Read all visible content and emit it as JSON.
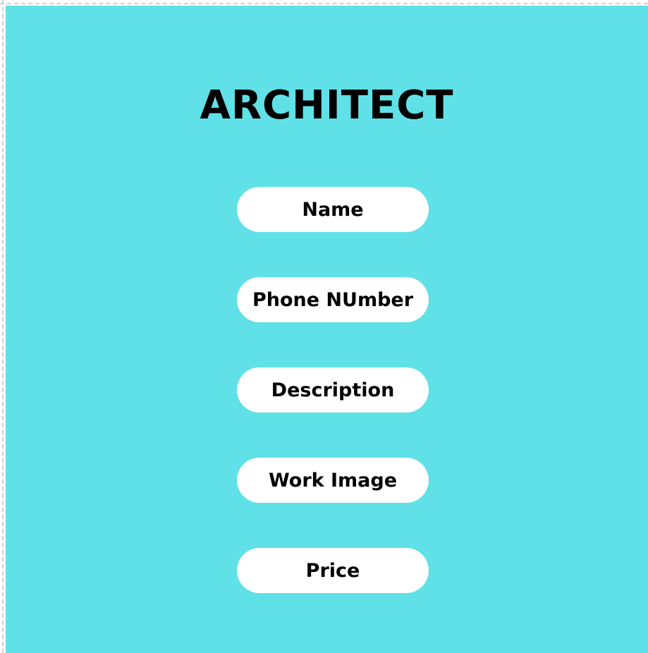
{
  "page": {
    "title": "ARCHITECT",
    "background_color": "#5fe1e7",
    "field_color": "#ffffff"
  },
  "fields": [
    {
      "label": "Name"
    },
    {
      "label": "Phone NUmber"
    },
    {
      "label": "Description"
    },
    {
      "label": "Work Image"
    },
    {
      "label": "Price"
    }
  ]
}
